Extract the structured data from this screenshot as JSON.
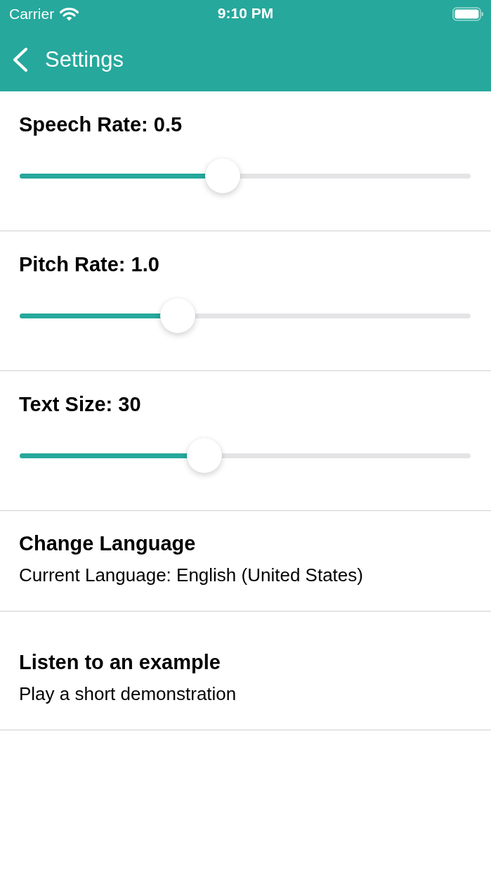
{
  "status_bar": {
    "carrier": "Carrier",
    "time": "9:10 PM"
  },
  "nav_bar": {
    "title": "Settings"
  },
  "sliders": [
    {
      "label": "Speech Rate: 0.5",
      "level": 0.45
    },
    {
      "label": "Pitch Rate: 1.0",
      "level": 0.35
    },
    {
      "label": "Text Size: 30",
      "level": 0.41
    }
  ],
  "options": [
    {
      "title": "Change Language",
      "subtitle": "Current Language: English (United States)"
    },
    {
      "title": "Listen to an example",
      "subtitle": "Play a short demonstration"
    }
  ]
}
